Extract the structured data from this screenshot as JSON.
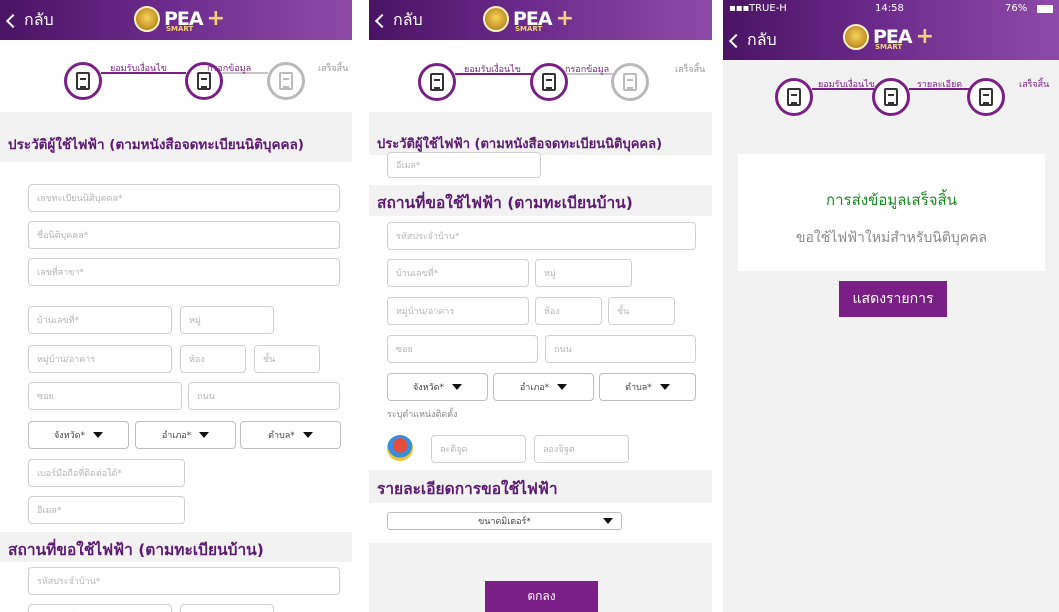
{
  "header": {
    "back_label": "กลับ",
    "logo_text": "PEA",
    "logo_sub": "SMART",
    "logo_plus": "+"
  },
  "status_bar": {
    "carrier": "TRUE-H",
    "time": "14:58",
    "battery": "76%"
  },
  "steps": {
    "step1": "ยอมรับเงื่อนไข",
    "step2_form": "กรอกข้อมูล",
    "step2_detail": "รายละเอียด",
    "step3": "เสร็จสิ้น"
  },
  "sections": {
    "corp_history": "ประวัติผู้ใช้ไฟฟ้า (ตามหนังสือจดทะเบียนนิติบุคคล)",
    "location": "สถานที่ขอใช้ไฟฟ้า (ตามทะเบียนบ้าน)",
    "request_detail": "รายละเอียดการขอใช้ไฟฟ้า"
  },
  "fields": {
    "corp_reg_no": "เลขทะเบียนนิติบุคคล*",
    "corp_name": "ชื่อนิติบุคคล*",
    "branch_no": "เลขที่สาขา*",
    "house_no": "บ้านเลขที่*",
    "moo": "หมู่",
    "village": "หมู่บ้าน/อาคาร",
    "room": "ห้อง",
    "floor": "ชั้น",
    "soi": "ซอย",
    "road": "ถนน",
    "province": "จังหวัด*",
    "district": "อำเภอ*",
    "subdistrict": "ตำบล*",
    "mobile": "เบอร์มือถือที่ติดต่อได้*",
    "email": "อีเมล*",
    "house_code": "รหัสประจำบ้าน*",
    "location_hint": "ระบุตำแหน่งติดตั้ง",
    "latitude": "ละติจูด",
    "longitude": "ลองจิจูด",
    "meter_size": "ขนาดมิเตอร์*"
  },
  "buttons": {
    "ok": "ตกลง",
    "show_list": "แสดงรายการ"
  },
  "done": {
    "title": "การส่งข้อมูลเสร็จสิ้น",
    "subtitle": "ขอใช้ไฟฟ้าใหม่สำหรับนิติบุคคล"
  }
}
